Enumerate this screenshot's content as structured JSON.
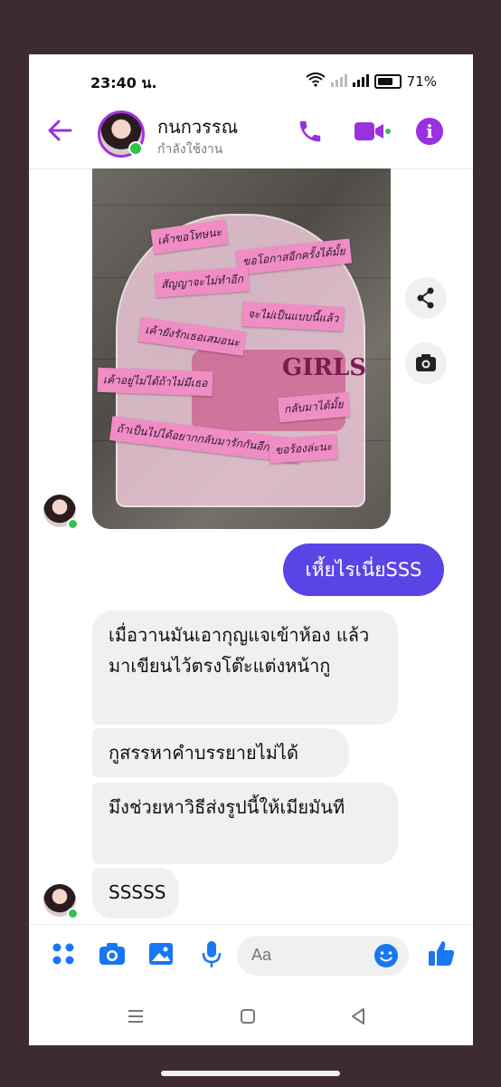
{
  "status_bar": {
    "time": "23:40 น.",
    "battery": "71%"
  },
  "header": {
    "contact_name": "กนกวรรณ",
    "presence": "กำลังใช้งาน"
  },
  "photo": {
    "notes": [
      "เค้าขอโทษนะ",
      "ขอโอกาสอีกครั้งได้มั้ย",
      "สัญญาจะไม่ทำอีก",
      "จะไม่เป็นแบบนี้แล้ว",
      "เค้ายังรักเธอเสมอนะ",
      "เค้าอยู่ไม่ได้ถ้าไม่มีเธอ",
      "กลับมาได้มั้ย",
      "ถ้าเป็นไปได้อยากกลับมารักกันอีกได้มั้ย",
      "ขอร้องล่ะนะ"
    ],
    "holder_text": "GIRLS"
  },
  "messages": {
    "outgoing_1": "เหี้ยไรเนี่ยSSS",
    "incoming_1": "เมื่อวานมันเอากุญแจเข้าห้อง แล้วมาเขียนไว้ตรงโต๊ะแต่งหน้ากู",
    "incoming_2": "กูสรรหาคำบรรยายไม่ได้",
    "incoming_3": "มึงช่วยหาวิธีส่งรูปนี้ให้เมียมันที",
    "incoming_4": "SSSSS"
  },
  "composer": {
    "placeholder": "Aa"
  },
  "colors": {
    "accent": "#9b30e0",
    "bubble_out": "#5b44e6",
    "bubble_in": "#f0f0f0",
    "blue_icon": "#1877f2",
    "online": "#31c24d"
  }
}
